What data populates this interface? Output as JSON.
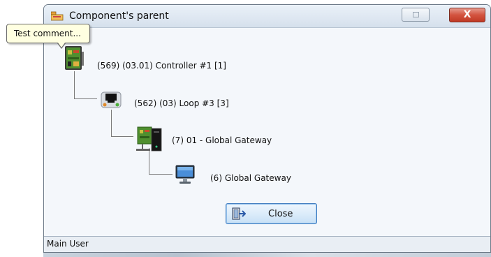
{
  "window": {
    "title": "Component's parent",
    "title_icon": "folder-tree-icon",
    "restore_icon": "restore-icon",
    "close_icon": "close-icon",
    "close_glyph": "X"
  },
  "tooltip": {
    "text": "Test comment..."
  },
  "tree": {
    "nodes": [
      {
        "label": "(569) (03.01) Controller #1 [1]",
        "icon": "controller-board-icon"
      },
      {
        "label": "(562) (03) Loop #3 [3]",
        "icon": "network-loop-icon"
      },
      {
        "label": "(7) 01 - Global Gateway",
        "icon": "gateway-server-icon"
      },
      {
        "label": "(6) Global Gateway",
        "icon": "computer-monitor-icon"
      }
    ]
  },
  "close_button": {
    "label": "Close",
    "icon": "door-exit-icon"
  },
  "status_bar": {
    "text": "Main User"
  },
  "colors": {
    "title_close_red": "#c03a25",
    "tooltip_bg": "#ffffe1",
    "button_border_blue": "#3d7bbf",
    "window_bg": "#eef2f7"
  }
}
